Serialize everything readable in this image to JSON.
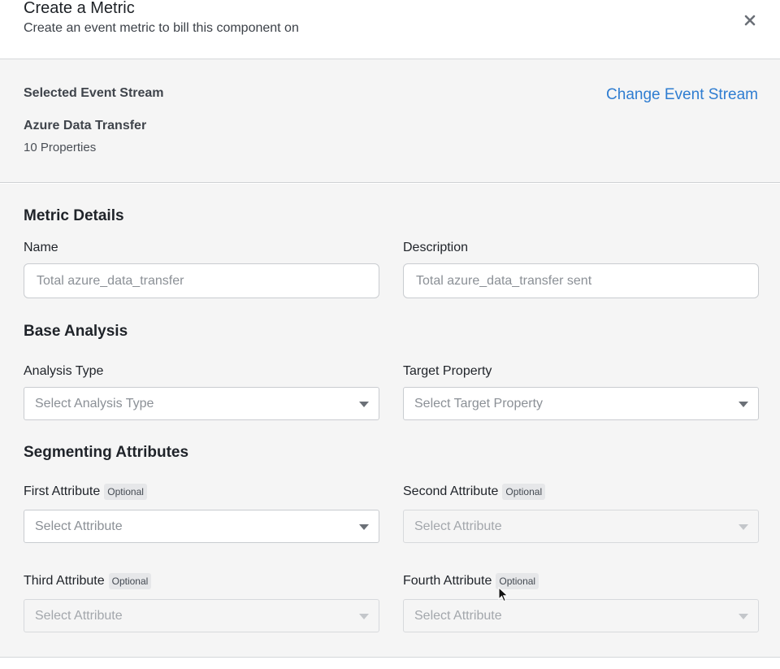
{
  "header": {
    "title": "Create a Metric",
    "subtitle": "Create an event metric to bill this component on"
  },
  "event_stream": {
    "label": "Selected Event Stream",
    "change_link": "Change Event Stream",
    "name": "Azure Data Transfer",
    "properties": "10 Properties"
  },
  "metric_details": {
    "title": "Metric Details",
    "name_label": "Name",
    "name_placeholder": "Total azure_data_transfer",
    "description_label": "Description",
    "description_placeholder": "Total azure_data_transfer sent"
  },
  "base_analysis": {
    "title": "Base Analysis",
    "analysis_type_label": "Analysis Type",
    "analysis_type_placeholder": "Select Analysis Type",
    "target_property_label": "Target Property",
    "target_property_placeholder": "Select Target Property"
  },
  "segmenting": {
    "title": "Segmenting Attributes",
    "optional": "Optional",
    "attributes": [
      {
        "label": "First Attribute",
        "placeholder": "Select Attribute",
        "disabled": false
      },
      {
        "label": "Second Attribute",
        "placeholder": "Select Attribute",
        "disabled": true
      },
      {
        "label": "Third Attribute",
        "placeholder": "Select Attribute",
        "disabled": true
      },
      {
        "label": "Fourth Attribute",
        "placeholder": "Select Attribute",
        "disabled": true
      }
    ]
  },
  "icons": {
    "close": "close-icon",
    "dropdown": "chevron-down-icon",
    "cursor": "mouse-pointer-icon"
  },
  "colors": {
    "link": "#2f7dd1",
    "panel_bg": "#f5f5f5"
  }
}
